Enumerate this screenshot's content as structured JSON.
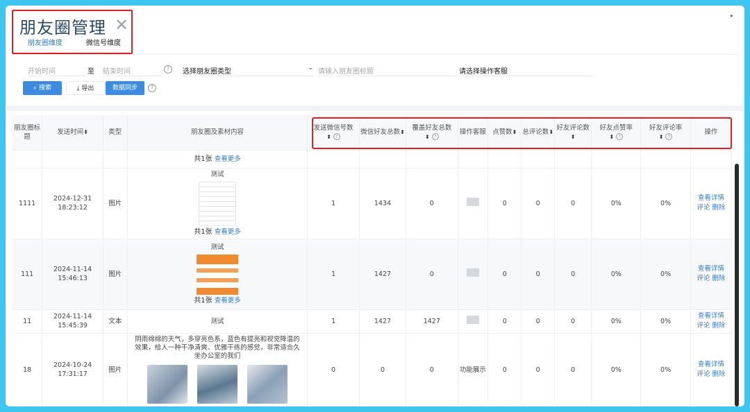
{
  "app": {
    "title": "朋友圈管理",
    "close_glyph": "✕",
    "more_glyph": "▸"
  },
  "tabs": [
    {
      "label": "朋友圈维度",
      "active": true
    },
    {
      "label": "微信号维度",
      "active": false
    }
  ],
  "filters": {
    "start_placeholder": "开始时间",
    "to_label": "至",
    "end_placeholder": "结束时间",
    "type_select": "选择朋友圈类型",
    "title_placeholder": "请输入朋友圈标题",
    "operator_placeholder": "请选择操作客服"
  },
  "buttons": {
    "search": "搜索",
    "export": "导出",
    "sync": "数据同步"
  },
  "icons": {
    "search": "search-icon",
    "export": "download-icon",
    "help": "question-circle-icon",
    "sort": "sort-icon",
    "dropdown": "chevron-down-icon"
  },
  "colors": {
    "accent": "#3c8be0",
    "highlight": "#e02020",
    "link": "#2f7dd1",
    "background": "#3ec6f0"
  },
  "table": {
    "columns": [
      "朋友圈标题",
      "发送时间",
      "类型",
      "朋友圈及素材内容",
      "发送微信号数",
      "微信好友总数",
      "覆盖好友总数",
      "操作客服",
      "点赞数",
      "总评论数",
      "好友评论数",
      "好友点赞率",
      "好友评论率",
      "操作"
    ],
    "more_text": "共1张",
    "more_link": "查看更多",
    "action_detail": "查看详情",
    "action_comment": "评论",
    "action_delete": "删除",
    "rows": [
      {
        "id": "1111",
        "time_date": "2024-12-31",
        "time_clock": "18:23:12",
        "type": "图片",
        "content_title": "测试",
        "send_count": "1",
        "friend_total": "1434",
        "cover_total": "0",
        "operator": "",
        "likes": "0",
        "comments": "0",
        "friend_comments": "0",
        "like_rate": "0%",
        "comment_rate": "0%"
      },
      {
        "id": "111",
        "time_date": "2024-11-14",
        "time_clock": "15:46:13",
        "type": "图片",
        "content_title": "测试",
        "send_count": "1",
        "friend_total": "1427",
        "cover_total": "0",
        "operator": "",
        "likes": "0",
        "comments": "0",
        "friend_comments": "0",
        "like_rate": "0%",
        "comment_rate": "0%"
      },
      {
        "id": "11",
        "time_date": "2024-11-14",
        "time_clock": "15:45:39",
        "type": "文本",
        "content_title": "测试",
        "send_count": "1",
        "friend_total": "1427",
        "cover_total": "1427",
        "operator": "",
        "likes": "0",
        "comments": "0",
        "friend_comments": "0",
        "like_rate": "0%",
        "comment_rate": "0%"
      },
      {
        "id": "18",
        "time_date": "2024-10-24",
        "time_clock": "17:31:17",
        "type": "图片",
        "content_title": "阴雨绵绵的天气，多穿亮色系，蓝色有提亮和视觉降温的效果，给人一种干净清爽、优雅干练的感觉，非常适合久坐办公室的我们",
        "send_count": "0",
        "friend_total": "0",
        "cover_total": "0",
        "operator": "功能展示",
        "likes": "0",
        "comments": "0",
        "friend_comments": "0",
        "like_rate": "0%",
        "comment_rate": "0%"
      }
    ]
  }
}
